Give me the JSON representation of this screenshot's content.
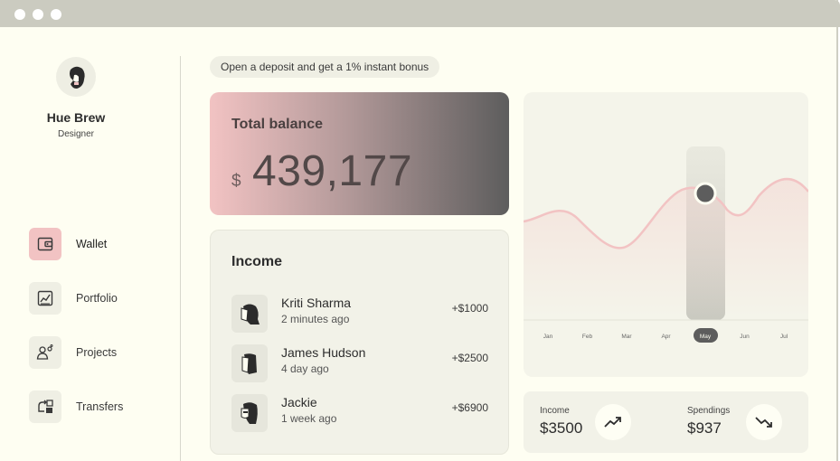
{
  "profile": {
    "name": "Hue Brew",
    "role": "Designer",
    "avatar_icon": "bearded-man-avatar-icon"
  },
  "nav": [
    {
      "label": "Wallet",
      "icon": "wallet-icon",
      "active": true
    },
    {
      "label": "Portfolio",
      "icon": "chart-icon",
      "active": false
    },
    {
      "label": "Projects",
      "icon": "team-icon",
      "active": false
    },
    {
      "label": "Transfers",
      "icon": "transfer-icon",
      "active": false
    }
  ],
  "promo": "Open a deposit and get a 1% instant bonus",
  "balance": {
    "title": "Total balance",
    "currency": "$",
    "amount": "439,177"
  },
  "income": {
    "title": "Income",
    "transactions": [
      {
        "name": "Kriti Sharma",
        "time": "2 minutes ago",
        "amount": "+$1000"
      },
      {
        "name": "James Hudson",
        "time": "4 day ago",
        "amount": "+$2500"
      },
      {
        "name": "Jackie",
        "time": "1 week ago",
        "amount": "+$6900"
      }
    ]
  },
  "chart_data": {
    "type": "area",
    "x": [
      "Jan",
      "Feb",
      "Mar",
      "Apr",
      "May",
      "Jun",
      "Jul"
    ],
    "selected": "May"
  },
  "stats": {
    "income": {
      "label": "Income",
      "value": "$3500",
      "icon": "trending-up-icon"
    },
    "spendings": {
      "label": "Spendings",
      "value": "$937",
      "icon": "trending-down-icon"
    }
  },
  "colors": {
    "accent": "#f2c3c3",
    "dark": "#5d5d5d",
    "background": "#fefef2"
  }
}
